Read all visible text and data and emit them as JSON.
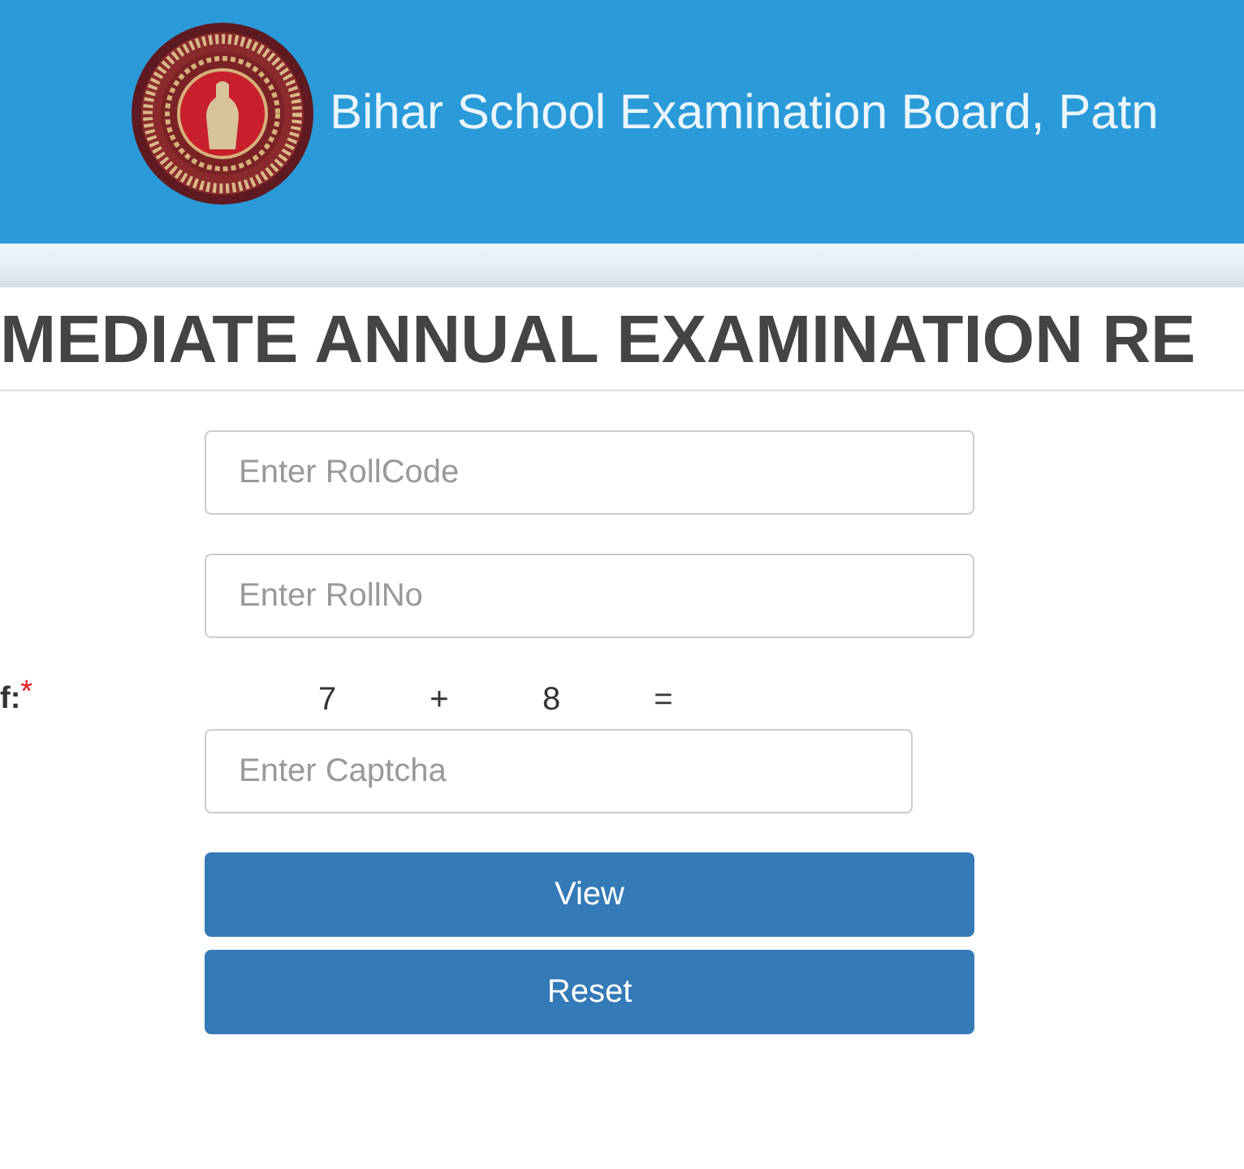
{
  "header": {
    "title": "Bihar School Examination Board, Patn"
  },
  "page_heading": "MEDIATE ANNUAL EXAMINATION RE",
  "form": {
    "fields": [
      {
        "placeholder": "Enter RollCode"
      },
      {
        "placeholder": "Enter RollNo"
      }
    ],
    "captcha": {
      "label": "f:",
      "required_mark": "*",
      "question": [
        "7",
        "+",
        "8",
        "="
      ],
      "placeholder": "Enter Captcha"
    },
    "buttons": [
      "View",
      "Reset"
    ]
  }
}
